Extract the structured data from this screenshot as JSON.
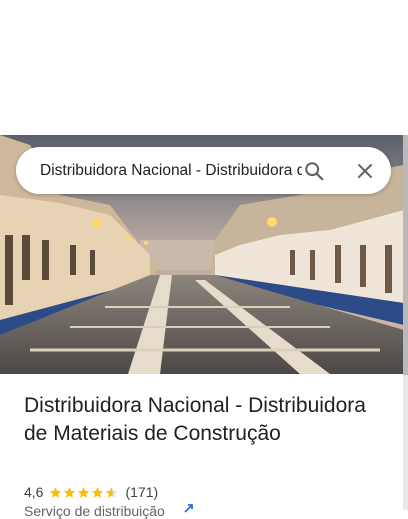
{
  "search": {
    "value": "Distribuidora Nacional - Distribuidora de Materiais de Construção"
  },
  "place": {
    "title": "Distribuidora Nacional - Distribuidora de Materiais de Construção",
    "rating": "4,6",
    "rating_value": 4.6,
    "review_count": "(171)",
    "category": "Serviço de distribuição"
  },
  "colors": {
    "star": "#fbbc04",
    "link": "#1a73e8"
  },
  "icons": {
    "search": "search-icon",
    "close": "close-icon",
    "star": "star-icon"
  }
}
